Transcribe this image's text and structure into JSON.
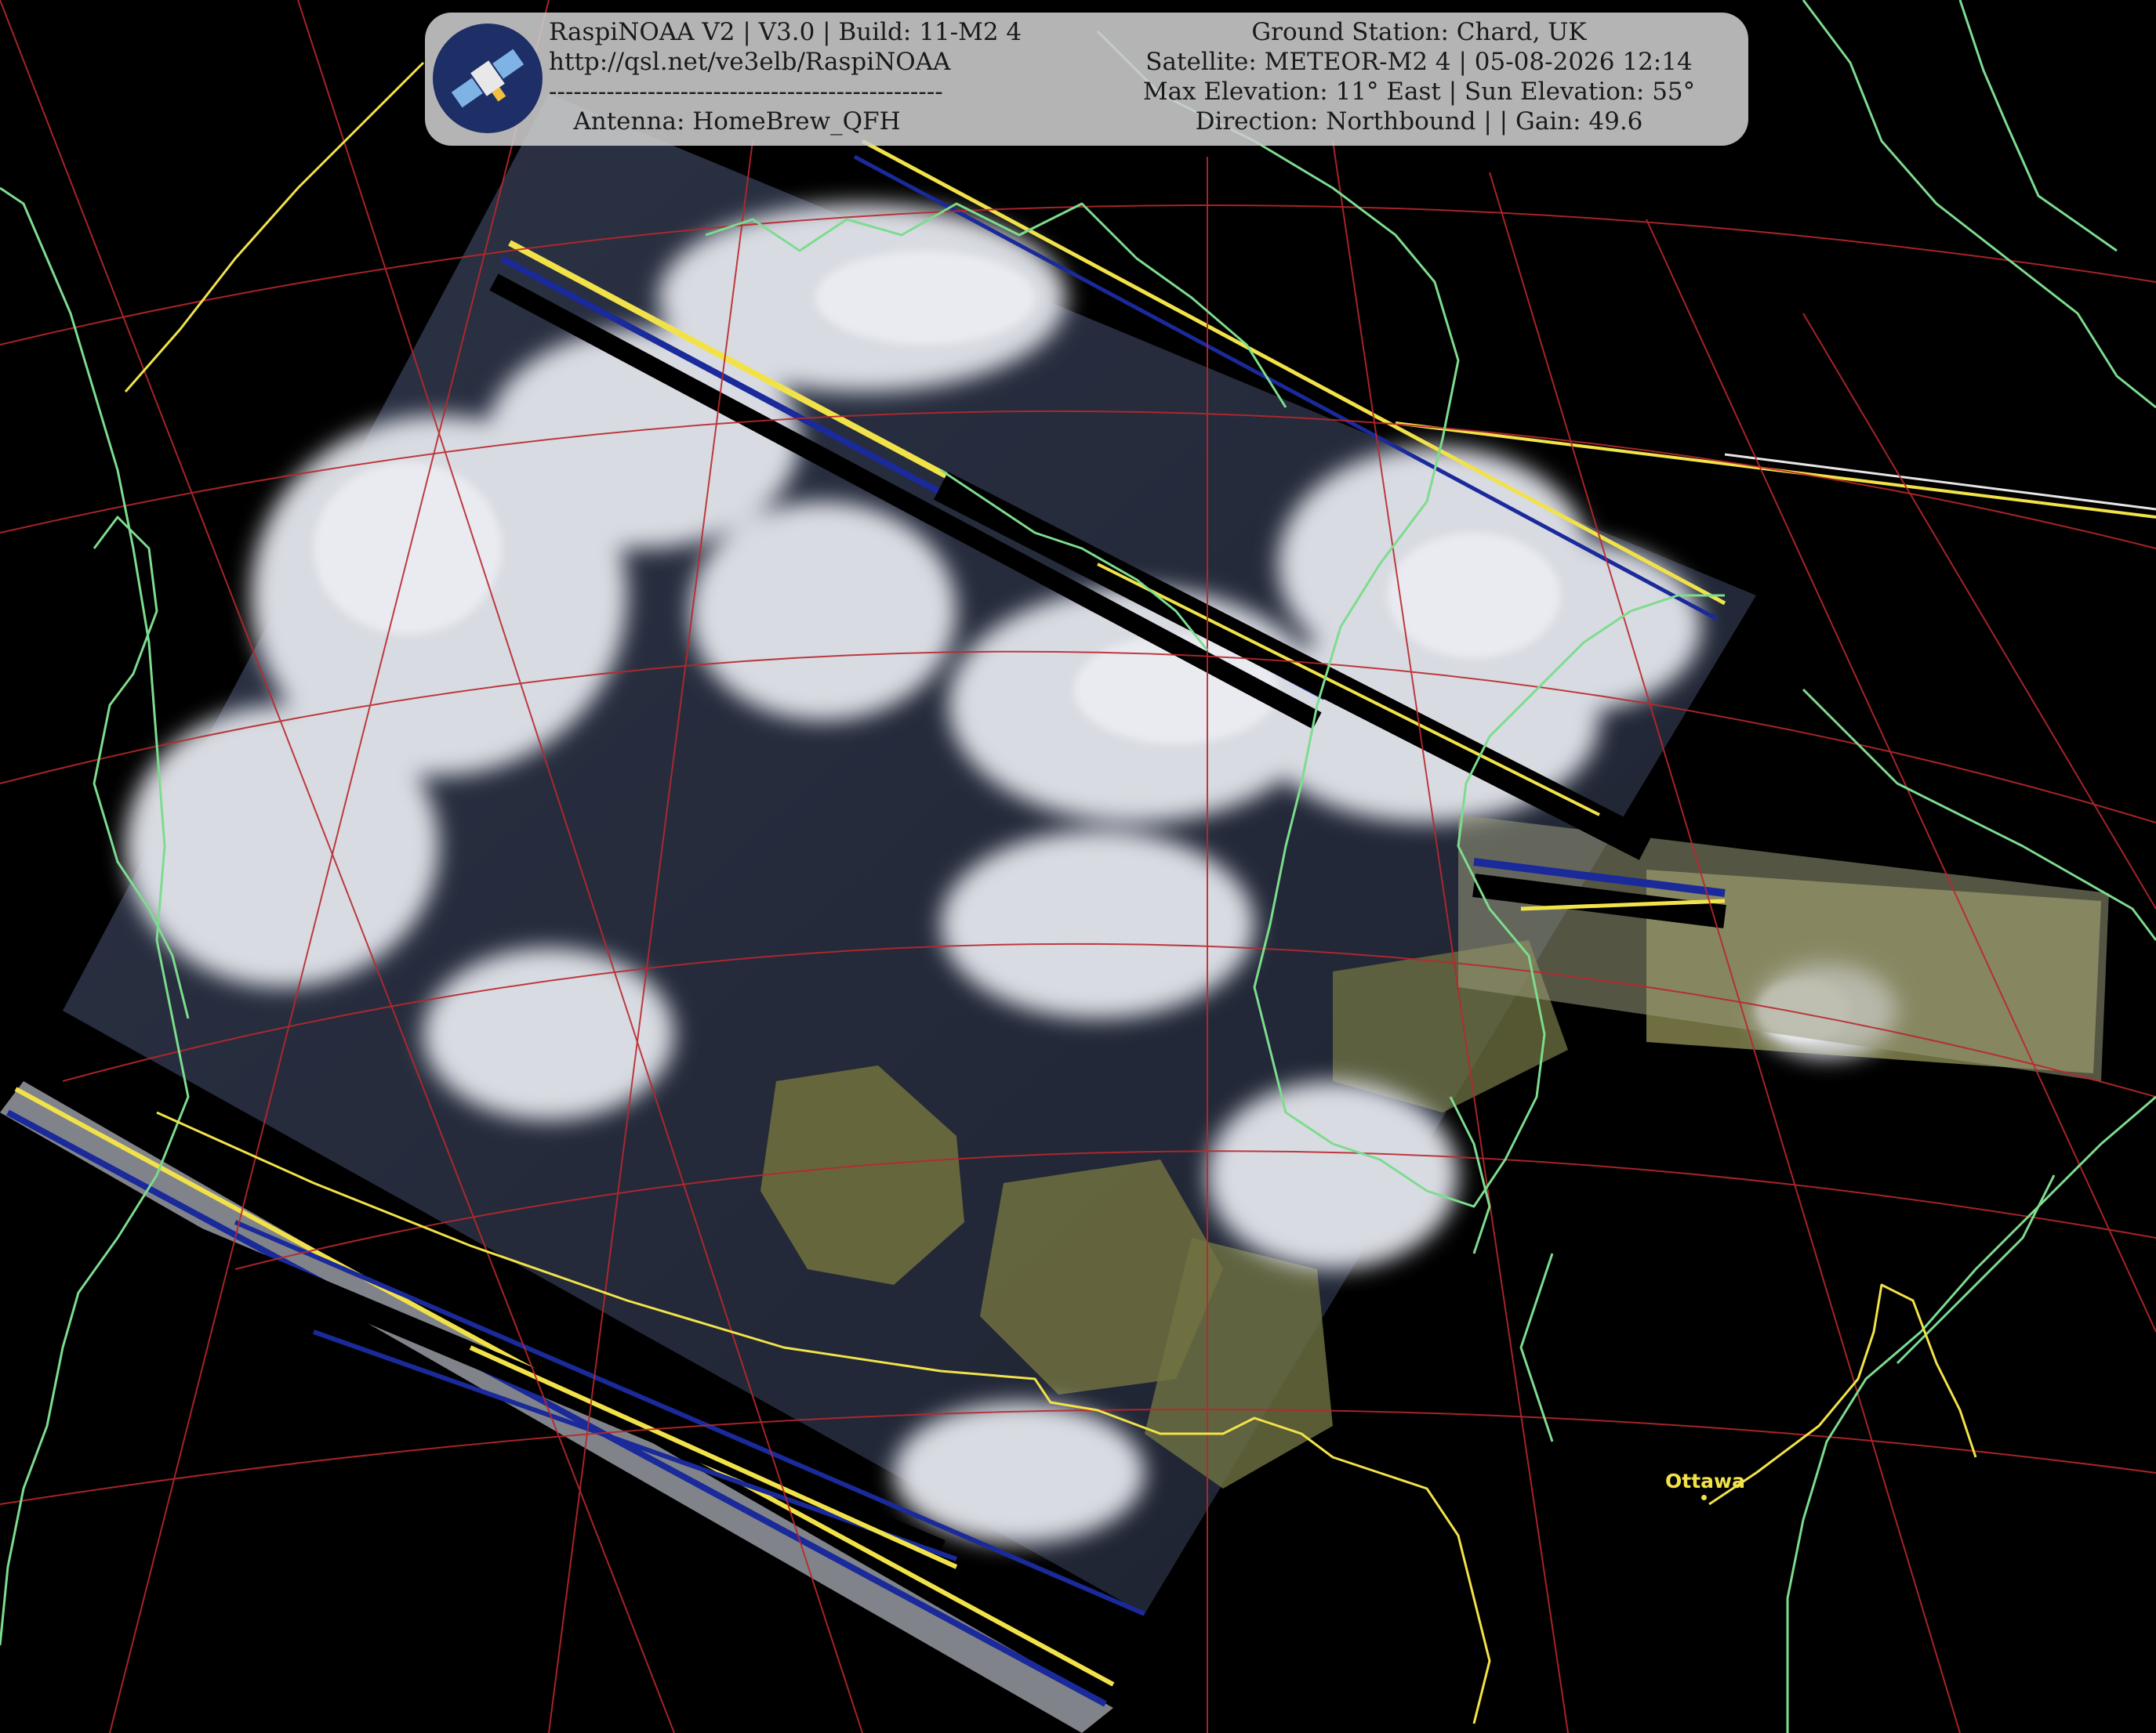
{
  "banner": {
    "left_lines": [
      "RaspiNOAA V2 | V3.0 | Build: 11-M2 4",
      "http://qsl.net/ve3elb/RaspiNOAA",
      "------------------------------------------------",
      "Antenna: HomeBrew_QFH"
    ],
    "right_lines": [
      "Ground Station: Chard, UK",
      "Satellite: METEOR-M2 4 | 05-08-2026 12:14",
      "Max Elevation: 11° East | Sun Elevation: 55°",
      "Direction: Northbound | | Gain: 49.6"
    ]
  },
  "map": {
    "city_label": "Ottawa",
    "colors": {
      "background": "#000000",
      "coastline": "#7ddc8e",
      "border": "#f2e24a",
      "graticule": "#b8282d",
      "banner": "#cdcdcd"
    }
  }
}
